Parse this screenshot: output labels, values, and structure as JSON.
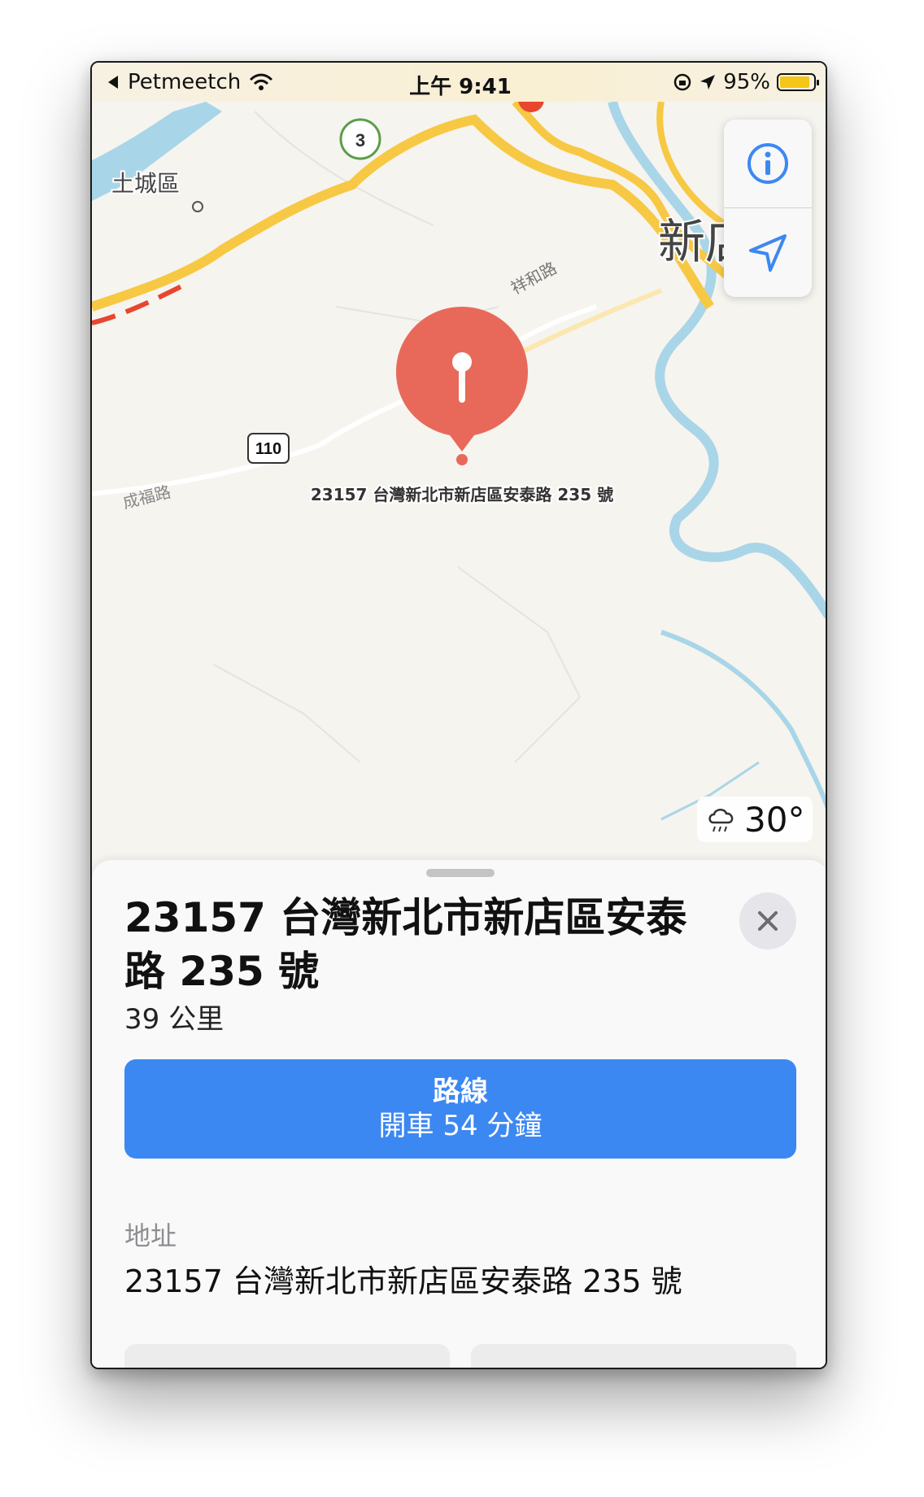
{
  "status_bar": {
    "back_app": "Petmeetch",
    "time": "上午 9:41",
    "battery_percent": "95%",
    "battery_level": 0.95
  },
  "map": {
    "labels": {
      "district_tucheng": "土城區",
      "district_xindian": "新店",
      "road_xianghe": "祥和路",
      "road_chengfu": "成福路",
      "route_3": "3",
      "route_110": "110"
    },
    "pin_label": "23157 台灣新北市新店區安泰路 235 號",
    "weather": {
      "temperature": "30°",
      "icon": "cloud-rain-icon"
    },
    "controls": {
      "info_icon": "info-icon",
      "location_icon": "location-arrow-icon"
    },
    "colors": {
      "pin": "#e8695a",
      "highway": "#f7c843",
      "congestion": "#e8462e",
      "water": "#a9d5e8",
      "accent": "#3c88f2"
    }
  },
  "place_card": {
    "title_line1": "23157 台灣新北市新店區安泰",
    "title_line2": "路 235 號",
    "distance": "39 公里",
    "route_button": {
      "label": "路線",
      "eta": "開車 54 分鐘"
    },
    "address_label": "地址",
    "address": "23157 台灣新北市新店區安泰路 235 號"
  }
}
